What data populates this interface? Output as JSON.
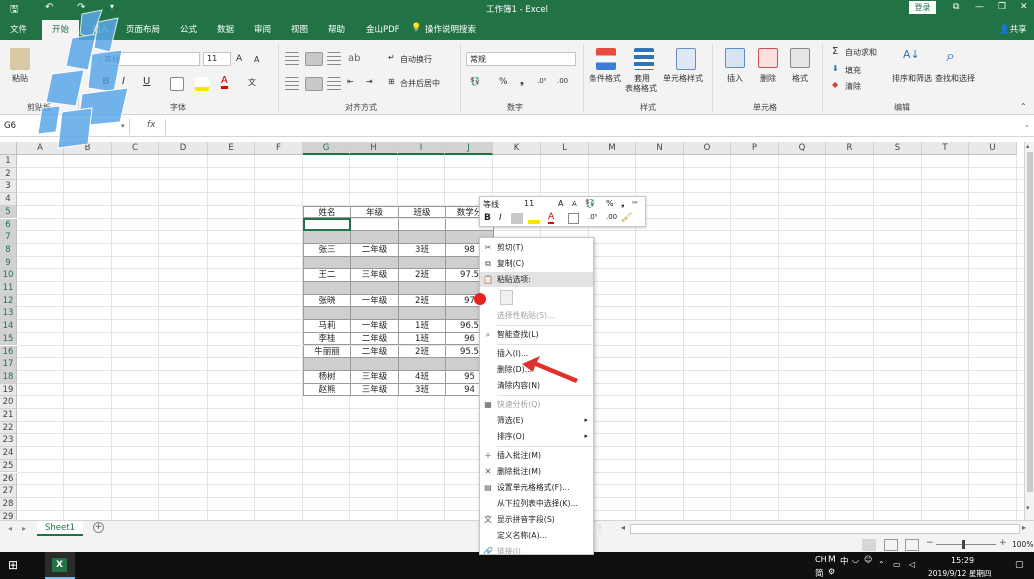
{
  "titlebar": {
    "doc_title": "工作簿1 - Excel",
    "login": "登录",
    "qa_save": "🖫",
    "qa_undo": "↶",
    "qa_redo": "↷",
    "qa_more": "▾",
    "btn_ribbon_opts": "⧉",
    "btn_min": "—",
    "btn_max": "❐",
    "btn_close": "✕"
  },
  "tabs": [
    {
      "label": "文件"
    },
    {
      "label": "开始"
    },
    {
      "label": "插入"
    },
    {
      "label": "页面布局"
    },
    {
      "label": "公式"
    },
    {
      "label": "数据"
    },
    {
      "label": "审阅"
    },
    {
      "label": "视图"
    },
    {
      "label": "帮助"
    },
    {
      "label": "金山PDF"
    },
    {
      "label": "操作说明搜索"
    }
  ],
  "share": "共享",
  "ribbon": {
    "clipboard": {
      "paste": "粘贴",
      "group": "剪贴板"
    },
    "font": {
      "name": "等线",
      "size": "11",
      "bold": "B",
      "italic": "I",
      "underline": "U",
      "grow": "A",
      "shrink": "A",
      "group": "字体"
    },
    "alignment": {
      "wrap": "自动换行",
      "merge": "合并后居中",
      "group": "对齐方式"
    },
    "number": {
      "format": "常规",
      "percent": "%",
      "comma": "❟",
      "group": "数字"
    },
    "styles": {
      "conditional": "条件格式",
      "table_l1": "套用",
      "table_l2": "表格格式",
      "cell_styles": "单元格样式",
      "group": "样式"
    },
    "cells": {
      "insert": "插入",
      "delete": "删除",
      "format": "格式",
      "group": "单元格"
    },
    "editing": {
      "autosum": "自动求和",
      "fill": "填充",
      "clear": "清除",
      "sort": "排序和筛选",
      "find": "查找和选择",
      "group": "编辑"
    }
  },
  "formula": {
    "name_box": "G6",
    "fx": "fx",
    "value": ""
  },
  "columns": [
    "A",
    "B",
    "C",
    "D",
    "E",
    "F",
    "G",
    "H",
    "I",
    "J",
    "K",
    "L",
    "M",
    "N",
    "O",
    "P",
    "Q",
    "R",
    "S",
    "T",
    "U"
  ],
  "rows": [
    "1",
    "2",
    "3",
    "4",
    "5",
    "6",
    "7",
    "8",
    "9",
    "10",
    "11",
    "12",
    "13",
    "14",
    "15",
    "16",
    "17",
    "18",
    "19",
    "20",
    "21",
    "22",
    "23",
    "24",
    "25",
    "26",
    "27",
    "28",
    "29"
  ],
  "table": {
    "headers": [
      "姓名",
      "年级",
      "班级",
      "数学分"
    ],
    "rows": [
      {
        "shade": false,
        "c": [
          "",
          "",
          "",
          ""
        ]
      },
      {
        "shade": true,
        "c": [
          "",
          "",
          "",
          ""
        ]
      },
      {
        "shade": false,
        "c": [
          "张三",
          "二年级",
          "3班",
          "98"
        ]
      },
      {
        "shade": true,
        "c": [
          "",
          "",
          "",
          ""
        ]
      },
      {
        "shade": false,
        "c": [
          "王二",
          "三年级",
          "2班",
          "97.5"
        ]
      },
      {
        "shade": true,
        "c": [
          "",
          "",
          "",
          ""
        ]
      },
      {
        "shade": false,
        "c": [
          "张晓",
          "一年级",
          "2班",
          "97"
        ]
      },
      {
        "shade": true,
        "c": [
          "",
          "",
          "",
          ""
        ]
      },
      {
        "shade": false,
        "c": [
          "马莉",
          "一年级",
          "1班",
          "96.5"
        ]
      },
      {
        "shade": false,
        "c": [
          "李桂",
          "二年级",
          "1班",
          "96"
        ]
      },
      {
        "shade": false,
        "c": [
          "牛丽丽",
          "二年级",
          "2班",
          "95.5"
        ]
      },
      {
        "shade": true,
        "c": [
          "",
          "",
          "",
          ""
        ]
      },
      {
        "shade": false,
        "c": [
          "杨树",
          "三年级",
          "4班",
          "95"
        ]
      },
      {
        "shade": false,
        "c": [
          "赵熊",
          "三年级",
          "3班",
          "94"
        ]
      }
    ]
  },
  "mini_toolbar": {
    "font": "等线",
    "size": "11",
    "bold": "B",
    "italic": "I",
    "percent": "%",
    "comma": "❟"
  },
  "context_menu": [
    {
      "label": "剪切(T)",
      "icon": "✂",
      "dis": false
    },
    {
      "label": "复制(C)",
      "icon": "⧉",
      "dis": false
    },
    {
      "label": "粘贴选项:",
      "icon": "📋",
      "dis": false,
      "hl": true
    },
    {
      "label": "",
      "icon": "📋",
      "dis": false,
      "pasteicon": true
    },
    {
      "label": "选择性粘贴(S)...",
      "icon": "",
      "dis": true
    },
    {
      "sep": true
    },
    {
      "label": "智能查找(L)",
      "icon": "⌕",
      "dis": false
    },
    {
      "sep": true
    },
    {
      "label": "插入(I)...",
      "icon": "",
      "dis": false
    },
    {
      "label": "删除(D)...",
      "icon": "",
      "dis": false
    },
    {
      "label": "清除内容(N)",
      "icon": "",
      "dis": false
    },
    {
      "sep": true
    },
    {
      "label": "快速分析(Q)",
      "icon": "▦",
      "dis": true
    },
    {
      "label": "筛选(E)",
      "icon": "",
      "dis": false,
      "sub": true
    },
    {
      "label": "排序(O)",
      "icon": "",
      "dis": false,
      "sub": true
    },
    {
      "sep": true
    },
    {
      "label": "插入批注(M)",
      "icon": "＋",
      "dis": false
    },
    {
      "label": "删除批注(M)",
      "icon": "✕",
      "dis": false
    },
    {
      "label": "设置单元格格式(F)...",
      "icon": "▤",
      "dis": false
    },
    {
      "label": "从下拉列表中选择(K)...",
      "icon": "",
      "dis": false
    },
    {
      "label": "显示拼音字段(S)",
      "icon": "文",
      "dis": false
    },
    {
      "label": "定义名称(A)...",
      "icon": "",
      "dis": false
    },
    {
      "label": "链接(I)",
      "icon": "🔗",
      "dis": true
    }
  ],
  "sheet_tab": "Sheet1",
  "zoom": "100%",
  "taskbar": {
    "ime1": "CH",
    "ime2": "中",
    "ime3": "简",
    "time": "15:29",
    "date": "2019/9/12 星期四"
  },
  "colors": {
    "excel_green": "#217346",
    "arrow": "#e0302a"
  }
}
